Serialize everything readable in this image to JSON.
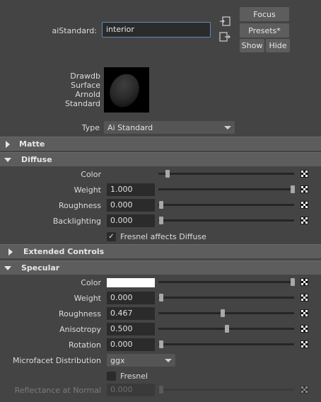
{
  "header": {
    "node_label": "aiStandard:",
    "node_name": "interior",
    "focus_label": "Focus",
    "presets_label": "Presets*",
    "show_label": "Show",
    "hide_label": "Hide"
  },
  "swatch": {
    "lines": [
      "Drawdb",
      "Surface",
      "Arnold",
      "Standard"
    ]
  },
  "type": {
    "label": "Type",
    "value": "Ai Standard"
  },
  "sections": {
    "matte": "Matte",
    "diffuse": "Diffuse",
    "extended": "Extended Controls",
    "specular": "Specular"
  },
  "diffuse": {
    "color_label": "Color",
    "color_level": 0.05,
    "weight_label": "Weight",
    "weight_value": "1.000",
    "weight_level": 1.0,
    "roughness_label": "Roughness",
    "roughness_value": "0.000",
    "roughness_level": 0.0,
    "backlighting_label": "Backlighting",
    "backlighting_value": "0.000",
    "backlighting_level": 0.0,
    "fresnel_label": "Fresnel affects Diffuse",
    "fresnel_checked": true
  },
  "specular": {
    "color_label": "Color",
    "color_hex": "#ffffff",
    "color_level": 1.0,
    "weight_label": "Weight",
    "weight_value": "0.000",
    "weight_level": 0.0,
    "roughness_label": "Roughness",
    "roughness_value": "0.467",
    "roughness_level": 0.467,
    "anisotropy_label": "Anisotropy",
    "anisotropy_value": "0.500",
    "anisotropy_level": 0.5,
    "rotation_label": "Rotation",
    "rotation_value": "0.000",
    "rotation_level": 0.0,
    "microfacet_label": "Microfacet Distribution",
    "microfacet_value": "ggx",
    "fresnel_label": "Fresnel",
    "fresnel_checked": false,
    "reflectance_label": "Reflectance at Normal",
    "reflectance_value": "0.000",
    "reflectance_level": 0.0
  },
  "colors": {
    "background": "#444444",
    "section_bar": "#5d5d5d",
    "field": "#2b2b2b",
    "focus_border": "#5d8bbd"
  },
  "icons": [
    "input-connection-icon",
    "output-connection-icon",
    "map-button-icon",
    "expand-arrow-icon",
    "collapse-arrow-icon",
    "checkmark-icon",
    "dropdown-arrow-icon"
  ]
}
